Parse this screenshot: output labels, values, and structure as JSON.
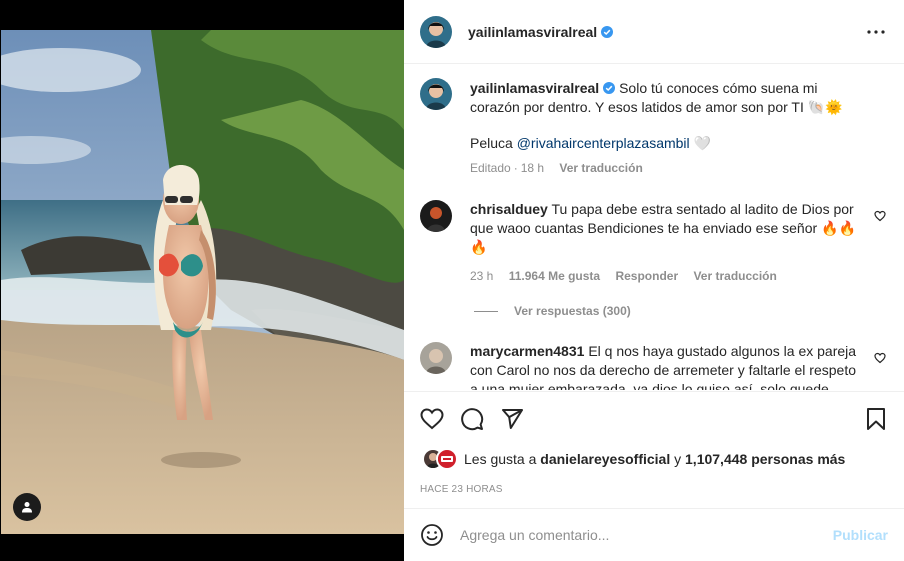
{
  "post": {
    "username": "yailinlamasviralreal",
    "caption": "Solo tú conoces cómo suena mi corazón por dentro. Y esos latidos de amor son por TI 🐚🌞",
    "caption_line2_prefix": "Peluca",
    "caption_mention": "@rivahaircenterplazasambil",
    "caption_line2_suffix": "🤍",
    "edited_label": "Editado",
    "age": "18 h",
    "translate": "Ver traducción"
  },
  "comments": [
    {
      "username": "chrisalduey",
      "text": "Tu papa debe estra sentado al ladito de Dios por que waoo cuantas Bendiciones te ha enviado ese señor 🔥🔥🔥",
      "age": "23 h",
      "likes": "11.964 Me gusta",
      "reply": "Responder",
      "translate": "Ver traducción",
      "view_replies": "Ver respuestas (300)"
    },
    {
      "username": "marycarmen4831",
      "text": "El q nos haya gustado algunos la ex pareja con Carol no nos da derecho de arremeter y faltarle el respeto a una mujer embarazada, ya dios lo quiso así, solo quede"
    }
  ],
  "likes": {
    "prefix": "Les gusta a",
    "user": "danielareyesofficial",
    "connector": "y",
    "count": "1,107,448 personas más"
  },
  "timestamp": "Hace 23 horas",
  "add_comment": {
    "placeholder": "Agrega un comentario...",
    "post_label": "Publicar"
  },
  "colors": {
    "verified": "#3897f0",
    "link": "#00376b",
    "muted": "#8e8e8e",
    "publish_disabled": "#b2dffc"
  },
  "icons": [
    "more-icon",
    "heart-icon",
    "comment-icon",
    "share-icon",
    "bookmark-icon",
    "emoji-icon",
    "user-tag-icon",
    "verified-icon"
  ]
}
